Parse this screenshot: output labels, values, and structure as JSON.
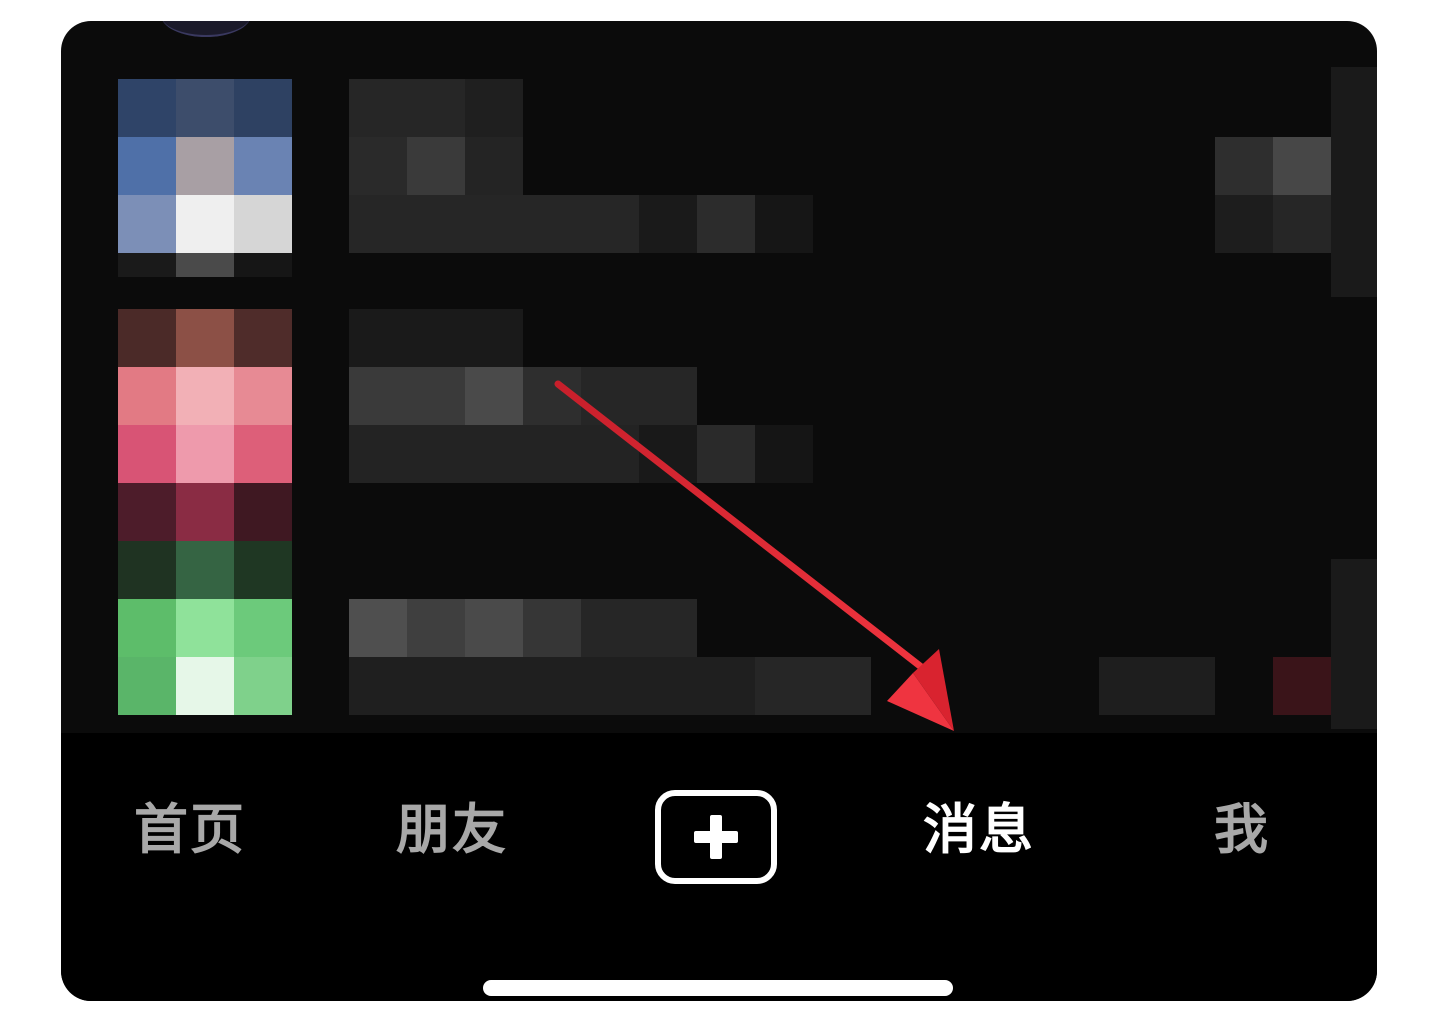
{
  "tab_bar": {
    "items": [
      {
        "label": "首页",
        "active": false
      },
      {
        "label": "朋友",
        "active": false
      },
      {
        "label": "消息",
        "active": true
      },
      {
        "label": "我",
        "active": false
      }
    ],
    "create_icon": "plus-icon"
  },
  "colors": {
    "background": "#0b0b0b",
    "tab_bar": "#000000",
    "active_tab": "#ffffff",
    "inactive_tab": "#a8a8a8",
    "annotation_arrow": "#e8333a"
  },
  "conversations": [
    {
      "avatar_palette": "blue",
      "content_state": "pixelated"
    },
    {
      "avatar_palette": "pink",
      "content_state": "pixelated"
    },
    {
      "avatar_palette": "green",
      "content_state": "pixelated"
    }
  ],
  "annotation": {
    "type": "arrow",
    "points_to": "消息"
  }
}
